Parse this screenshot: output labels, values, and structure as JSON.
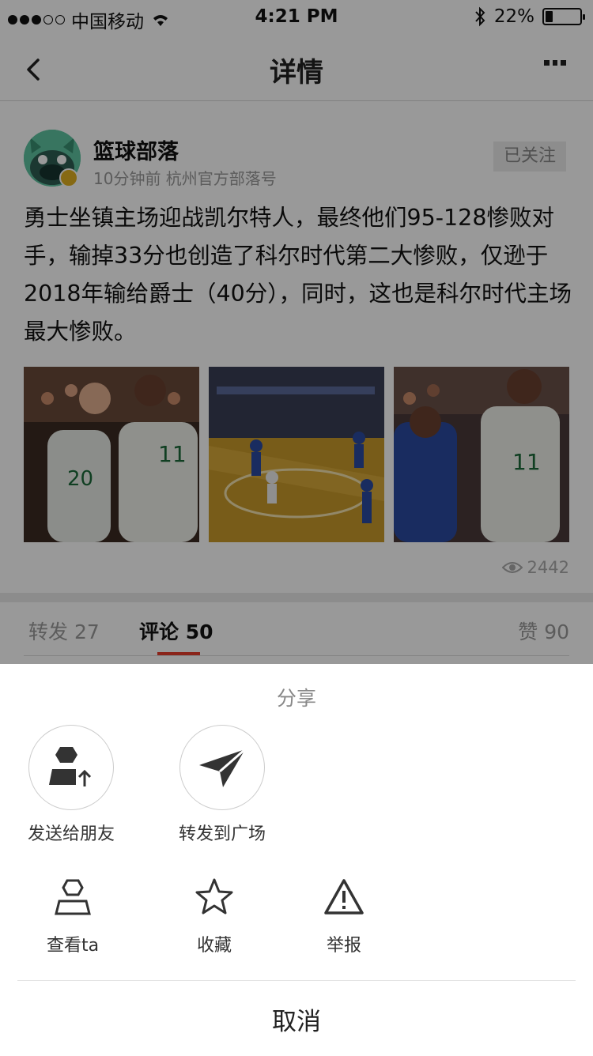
{
  "status_bar": {
    "carrier": "中国移动",
    "time": "4:21 PM",
    "battery_percent": "22%",
    "battery_level": 0.22
  },
  "nav": {
    "title": "详情"
  },
  "post": {
    "author": "篮球部落",
    "meta": "10分钟前 杭州官方部落号",
    "follow_label": "已关注",
    "content": "勇士坐镇主场迎战凯尔特人，最终他们95-128惨败对手，输掉33分也创造了科尔时代第二大惨败，仅逊于2018年输给爵士（40分），同时，这也是科尔时代主场最大惨败。",
    "views": "2442"
  },
  "tabs": [
    {
      "label": "转发",
      "count": "27"
    },
    {
      "label": "评论",
      "count": "50"
    },
    {
      "label": "赞",
      "count": "90"
    }
  ],
  "share_sheet": {
    "title": "分享",
    "share_items": [
      {
        "label": "发送给朋友",
        "icon": "send-to-friend-icon"
      },
      {
        "label": "转发到广场",
        "icon": "paper-plane-icon"
      }
    ],
    "actions": [
      {
        "label": "查看ta",
        "icon": "user-icon"
      },
      {
        "label": "收藏",
        "icon": "star-icon"
      },
      {
        "label": "举报",
        "icon": "warning-icon"
      }
    ],
    "cancel_label": "取消"
  },
  "colors": {
    "accent": "#e63c2c",
    "overlay": "rgba(0,0,0,0.4)"
  }
}
